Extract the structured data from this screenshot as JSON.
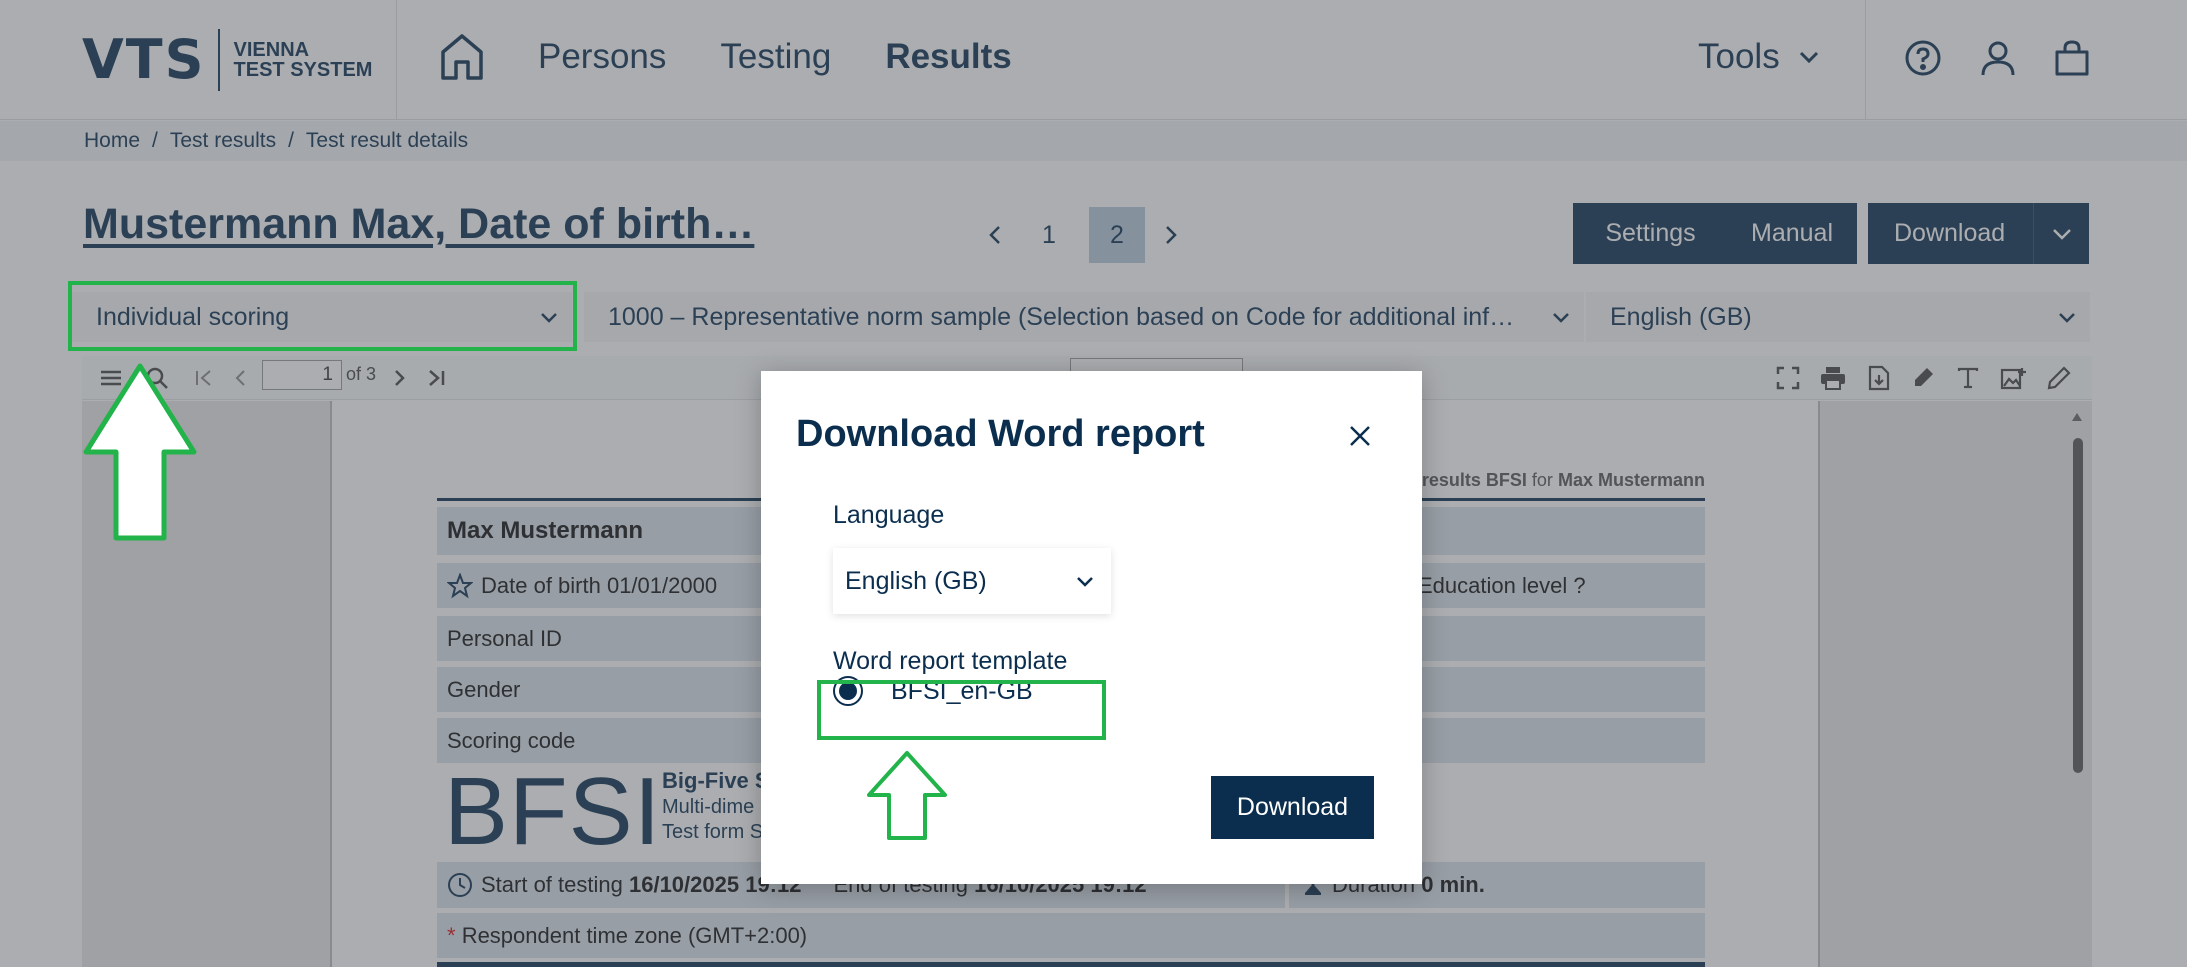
{
  "header": {
    "logo_mark": "VTS",
    "logo_line1": "VIENNA",
    "logo_line2": "TEST SYSTEM",
    "nav": [
      "Persons",
      "Testing",
      "Results"
    ],
    "active_nav": "Results",
    "tools_label": "Tools",
    "icons": [
      "home-icon",
      "help-icon",
      "user-icon",
      "shopping-bag-icon"
    ]
  },
  "breadcrumb": [
    "Home",
    "Test results",
    "Test result details"
  ],
  "title": "Mustermann Max, Date of birth…",
  "pager": {
    "pages": [
      "1",
      "2"
    ],
    "current": "2"
  },
  "buttons": {
    "settings": "Settings",
    "manual": "Manual",
    "download": "Download"
  },
  "selects": {
    "scoring": "Individual scoring",
    "norm": "1000 – Representative norm sample (Selection based on Code for additional inf…",
    "language": "English (GB)"
  },
  "viewer": {
    "page_value": "1",
    "of_text": "of 3"
  },
  "document": {
    "results_prefix": "results",
    "results_test": "BFSI",
    "results_for": "for",
    "results_name": "Max Mustermann",
    "name": "Max Mustermann",
    "dob": "Date of birth 01/01/2000",
    "education": "Education level ?",
    "personal_id": "Personal ID",
    "gender": "Gender",
    "scoring_code": "Scoring code",
    "big_logo": "BFSI",
    "sub_title": "Big-Five S",
    "sub_line2": "Multi-dime",
    "sub_line3": "Test form S",
    "start_label": "Start of testing",
    "start_value": "16/10/2025 19:12",
    "end_label": "End of testing",
    "end_value": "16/10/2025 19:12",
    "duration_label": "Duration",
    "duration_value": "0 min.",
    "timezone_asterisk": "*",
    "timezone": "Respondent time zone (GMT+2:00)"
  },
  "modal": {
    "title": "Download Word report",
    "language_label": "Language",
    "language_value": "English (GB)",
    "template_label": "Word report template",
    "template_option": "BFSI_en-GB",
    "download": "Download"
  },
  "colors": {
    "brand": "#0b2e4f",
    "highlight": "#22b34a",
    "overlay": "rgba(80,84,90,0.48)"
  }
}
